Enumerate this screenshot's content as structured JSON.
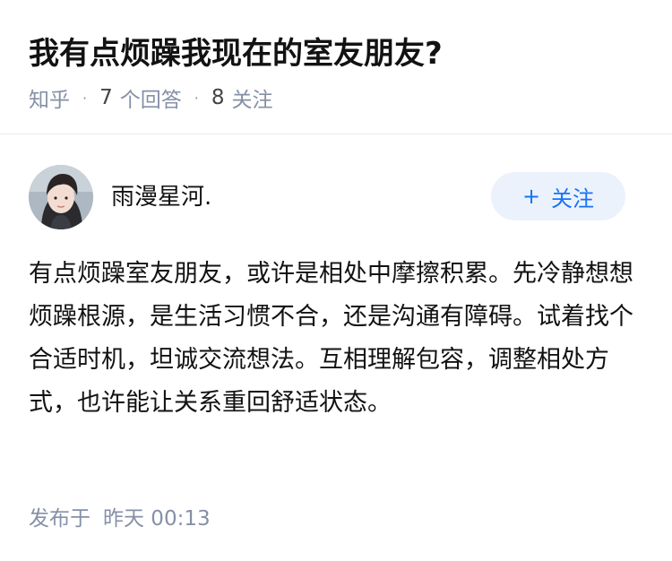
{
  "question": {
    "title": "我有点烦躁我现在的室友朋友?",
    "source": "知乎",
    "answers_count": "7",
    "answers_label": "个回答",
    "followers_count": "8",
    "followers_label": "关注"
  },
  "author": {
    "name": "雨漫星河.",
    "follow_plus": "+",
    "follow_label": "关注"
  },
  "answer": {
    "text": "有点烦躁室友朋友，或许是相处中摩擦积累。先冷静想想烦躁根源，是生活习惯不合，还是沟通有障碍。试着找个合适时机，坦诚交流想法。互相理解包容，调整相处方式，也许能让关系重回舒适状态。",
    "published_label": "发布于",
    "published_time": "昨天 00:13"
  },
  "colors": {
    "accent": "#1772f6",
    "follow_bg": "#ebf2fb",
    "meta_gray": "#8590a6"
  }
}
